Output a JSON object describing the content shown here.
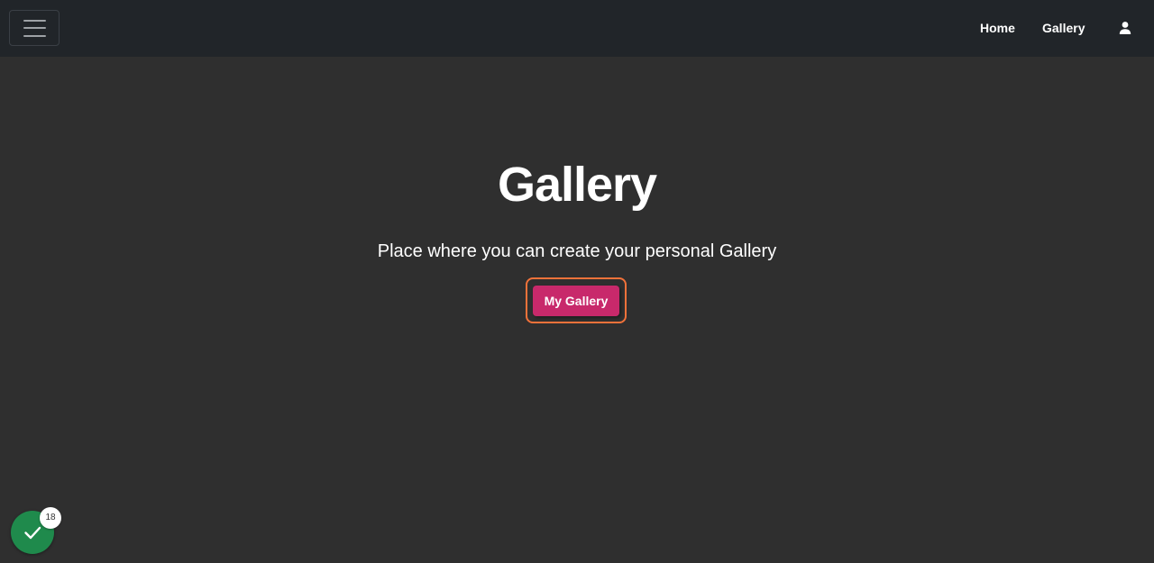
{
  "navbar": {
    "links": [
      {
        "label": "Home"
      },
      {
        "label": "Gallery"
      }
    ],
    "user_icon": "user-icon",
    "menu_icon": "hamburger-menu-icon"
  },
  "hero": {
    "title": "Gallery",
    "subtitle": "Place where you can create your personal Gallery",
    "button_label": "My Gallery"
  },
  "status_widget": {
    "icon": "check-icon",
    "badge_count": "18"
  },
  "colors": {
    "navbar_bg": "#212529",
    "page_bg": "#2f2f2f",
    "button_bg": "#c8296b",
    "focus_ring": "#f2723a",
    "status_green": "#1f8a4c"
  }
}
